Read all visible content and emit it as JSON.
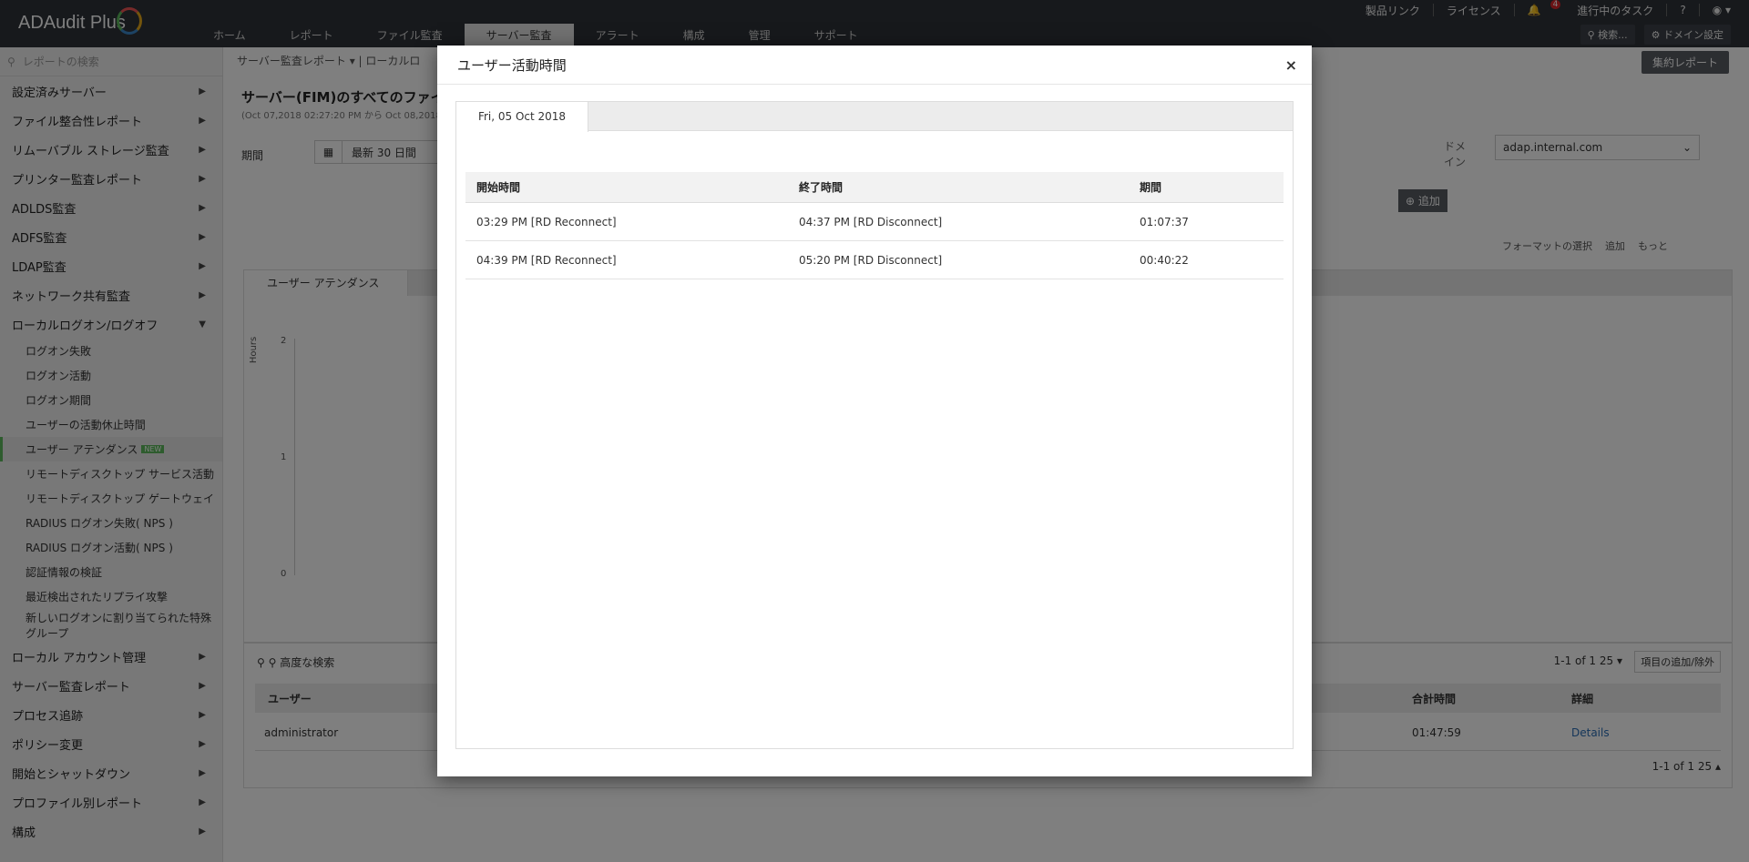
{
  "app": {
    "logo": "ADAudit Plus"
  },
  "nav": {
    "tabs": [
      "ホーム",
      "レポート",
      "ファイル監査",
      "サーバー監査",
      "アラート",
      "構成",
      "管理",
      "サポート"
    ]
  },
  "toplinks": {
    "product": "製品リンク",
    "license": "ライセンス",
    "bell_count": "4",
    "tasks": "進行中のタスク",
    "help": "?"
  },
  "topbtns": {
    "search": "検索...",
    "domain": "ドメイン設定"
  },
  "sidebar": {
    "search_placeholder": "レポートの検索",
    "items": [
      "設定済みサーバー",
      "ファイル整合性レポート",
      "リムーバブル ストレージ監査",
      "プリンター監査レポート",
      "ADLDS監査",
      "ADFS監査",
      "LDAP監査",
      "ネットワーク共有監査",
      "ローカルログオン/ログオフ"
    ],
    "subs": [
      "ログオン失敗",
      "ログオン活動",
      "ログオン期間",
      "ユーザーの活動休止時間",
      "ユーザー アテンダンス",
      "リモートディスクトップ サービス活動",
      "リモートディスクトップ ゲートウェイ",
      "RADIUS ログオン失敗( NPS )",
      "RADIUS ログオン活動( NPS )",
      "認証情報の検証",
      "最近検出されたリプライ攻撃",
      "新しいログオンに割り当てられた特殊グループ"
    ],
    "new_tag": "NEW",
    "items2": [
      "ローカル アカウント管理",
      "サーバー監査レポート",
      "プロセス追跡",
      "ポリシー変更",
      "開始とシャットダウン",
      "プロファイル別レポート",
      "構成"
    ]
  },
  "main": {
    "crumb": "サーバー監査レポート ▾  |  ローカルロ",
    "agg_label": "集約レポート",
    "title": "サーバー(FIM)のすべてのファイ",
    "subtitle": "(Oct 07,2018 02:27:20 PM から Oct 08,2018",
    "period_label": "期間",
    "period_value": "最新 30 日間",
    "domain_label": "ドメイン",
    "domain_value": "adap.internal.com",
    "add_label": "追加",
    "fmt": [
      "フォーマットの選択",
      "追加",
      "もっと"
    ],
    "chart_tab": "ユーザー アテンダンス",
    "y_axis": "Hours",
    "y_ticks": [
      "2",
      "1",
      "0"
    ],
    "tools": "高度な検索",
    "pager_top": "1-1 of 1   25 ▾",
    "add_remove": "項目の追加/除外",
    "table_headers": [
      "ユーザー",
      "合計時間",
      "詳細"
    ],
    "row": {
      "user": "administrator",
      "total": "01:47:59",
      "details": "Details"
    },
    "pager_bottom": "1-1 of 1   25 ▴"
  },
  "modal": {
    "title": "ユーザー活動時間",
    "close": "×",
    "tab": "Fri, 05 Oct 2018",
    "headers": [
      "開始時間",
      "終了時間",
      "期間"
    ],
    "rows": [
      {
        "start": "03:29 PM [RD Reconnect]",
        "end": "04:37 PM [RD Disconnect]",
        "dur": "01:07:37"
      },
      {
        "start": "04:39 PM [RD Reconnect]",
        "end": "05:20 PM [RD Disconnect]",
        "dur": "00:40:22"
      }
    ]
  }
}
